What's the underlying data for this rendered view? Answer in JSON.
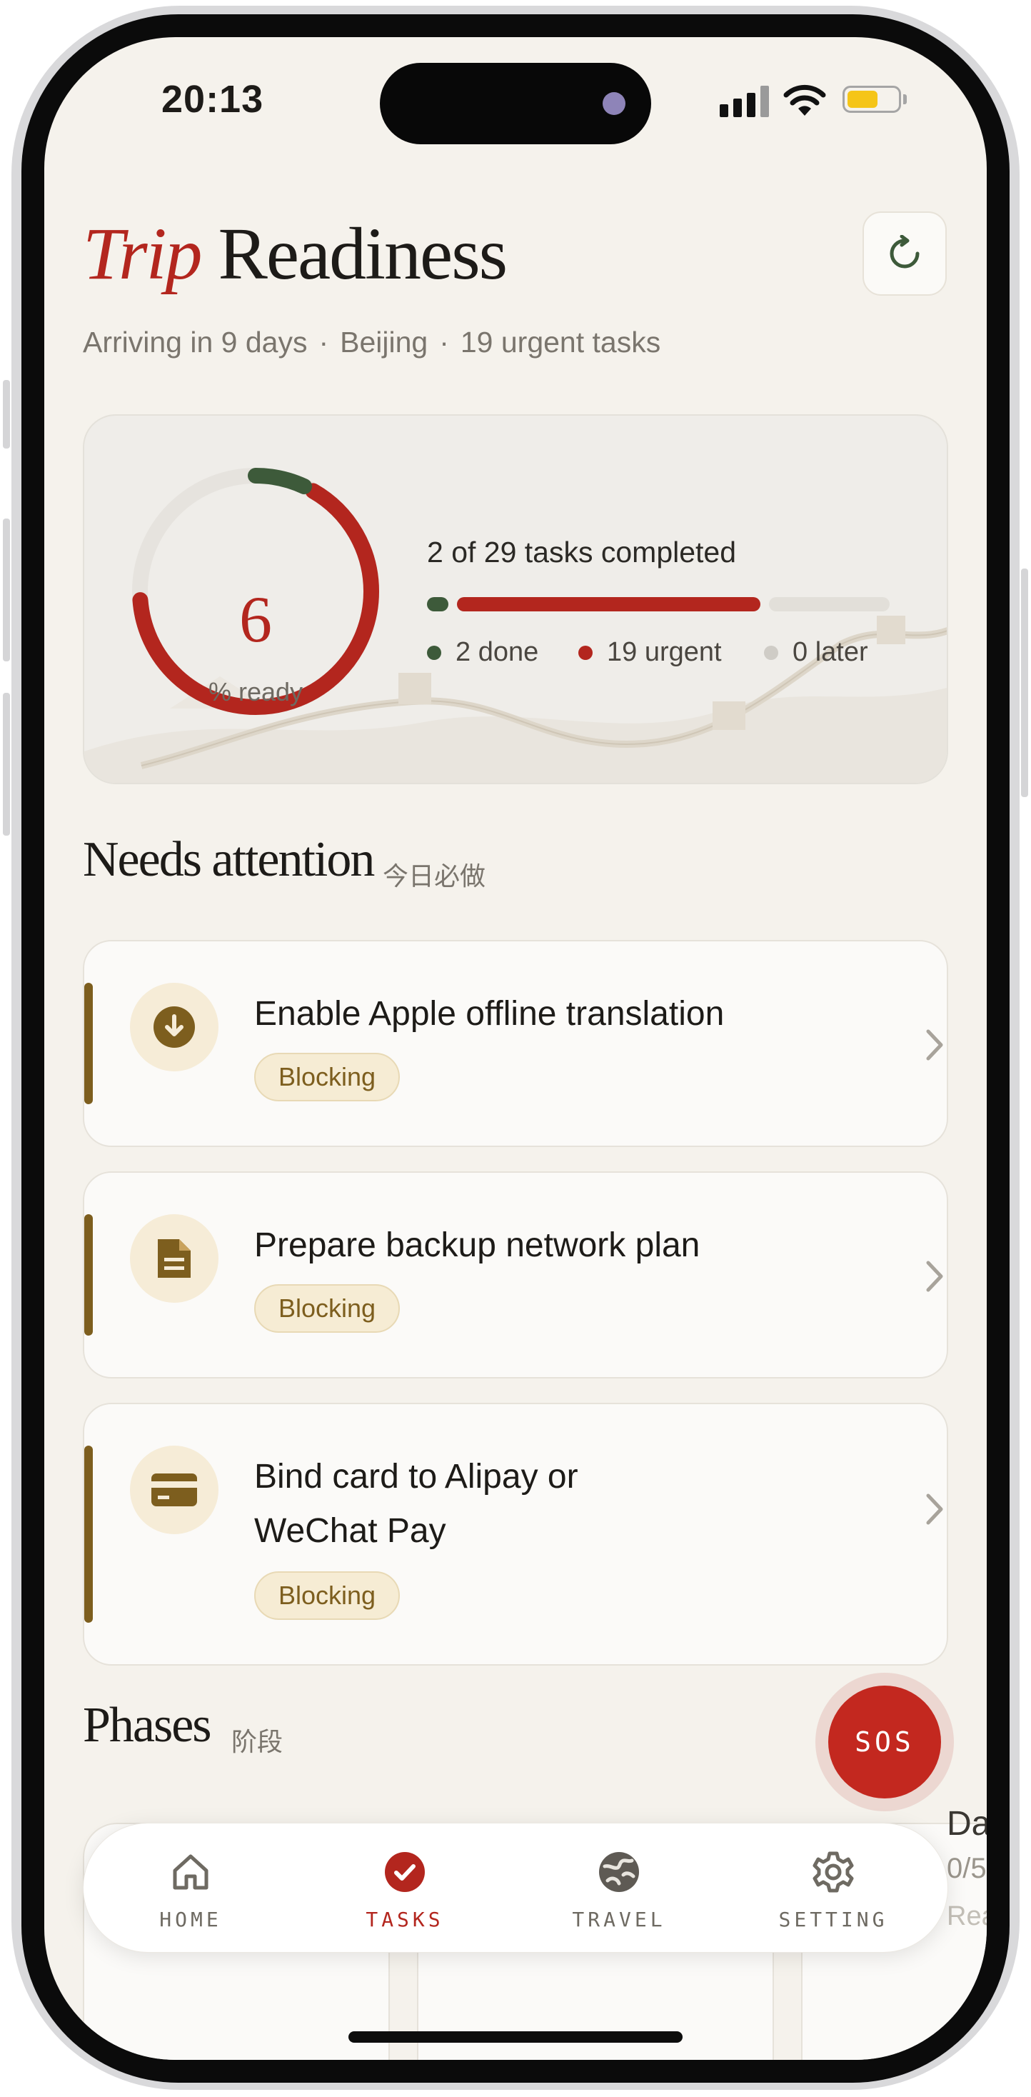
{
  "status_bar": {
    "time": "20:13"
  },
  "header": {
    "title_accent": "Trip",
    "title_main": "Readiness",
    "subtitle_arrival": "Arriving in 9 days",
    "subtitle_separator": "·",
    "subtitle_city": "Beijing",
    "subtitle_urgent": "19 urgent tasks",
    "refresh_icon": "refresh-icon"
  },
  "readiness": {
    "percent": "6",
    "percent_label": "% ready",
    "summary": "2 of 29 tasks completed",
    "done_fraction": 0.069,
    "urgent_fraction": 0.655,
    "legend": [
      {
        "label": "2 done",
        "color": "#3d5a3a"
      },
      {
        "label": "19 urgent",
        "color": "#b3261e"
      },
      {
        "label": "0 later",
        "color": "#cfccc6"
      }
    ]
  },
  "needs_attention": {
    "title": "Needs attention",
    "subtitle": "今日必做",
    "tasks": [
      {
        "title": "Enable Apple offline translation",
        "badge": "Blocking",
        "icon": "download-circle-icon"
      },
      {
        "title": "Prepare backup network plan",
        "badge": "Blocking",
        "icon": "document-icon"
      },
      {
        "title": "Bind card to Alipay or WeChat Pay",
        "badge": "Blocking",
        "icon": "credit-card-icon"
      }
    ]
  },
  "phases": {
    "title": "Phases",
    "subtitle": "阶段",
    "peek_title": "Da",
    "peek_count": "0/5",
    "peek_status": "Rea"
  },
  "sos": {
    "label": "SOS"
  },
  "tabbar": {
    "tabs": [
      {
        "label": "HOME",
        "icon": "home-icon"
      },
      {
        "label": "TASKS",
        "icon": "check-circle-icon",
        "active": true
      },
      {
        "label": "TRAVEL",
        "icon": "globe-icon"
      },
      {
        "label": "SETTING",
        "icon": "gear-icon"
      }
    ]
  },
  "colors": {
    "accent": "#b3261e",
    "done": "#3d5a3a",
    "blocking": "#7d5e1e",
    "background": "#f5f2ec"
  }
}
